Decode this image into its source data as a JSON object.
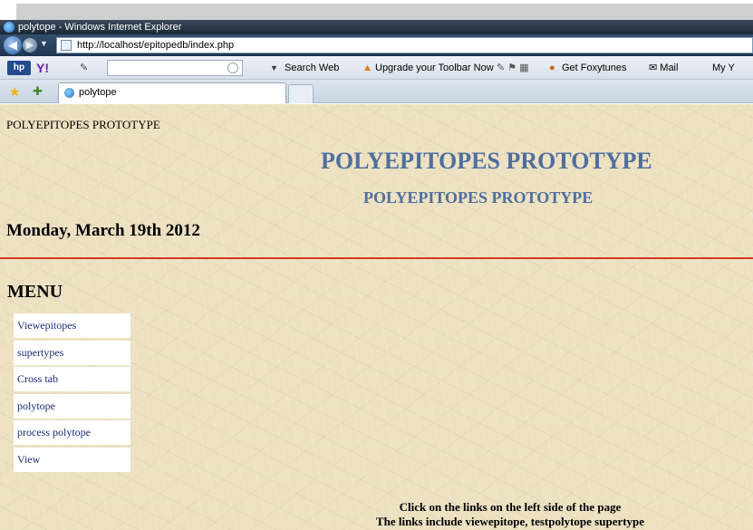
{
  "window": {
    "title": "polytope - Windows Internet Explorer",
    "url": "http://localhost/epitopedb/index.php"
  },
  "toolbar": {
    "y_label": "Y!",
    "search_web": "Search Web",
    "upgrade": "Upgrade your Toolbar Now",
    "get_foxytunes": "Get Foxytunes",
    "mail": "Mail",
    "my_y": "My Y"
  },
  "tab": {
    "label": "polytope"
  },
  "page": {
    "small_title": "POLYEPITOPES PROTOTYPE",
    "big_title": "POLYEPITOPES PROTOTYPE",
    "sub_title": "POLYEPITOPES PROTOTYPE",
    "date": "Monday, March 19th 2012",
    "menu_heading": "MENU",
    "menu_items": [
      {
        "label": "Viewepitopes"
      },
      {
        "label": "supertypes"
      },
      {
        "label": "Cross tab"
      },
      {
        "label": "polytope"
      },
      {
        "label": "process polytope"
      },
      {
        "label": "View"
      }
    ],
    "footer_line1": "Click on the links on the left side of the page",
    "footer_line2": "The links include viewepitope, testpolytope supertype"
  },
  "colors": {
    "heading_blue": "#4e6f9e",
    "rule_red": "#d23a22",
    "page_bg": "#ede1c2",
    "link_blue": "#1a2a78"
  },
  "icons": [
    "ie-icon",
    "back-arrow-icon",
    "forward-arrow-icon",
    "page-icon",
    "hp-logo-icon",
    "yahoo-icon",
    "pencil-icon",
    "search-icon",
    "warning-icon",
    "foxytunes-icon",
    "mail-icon",
    "favorites-star-icon",
    "add-favorites-icon",
    "tab-ie-icon"
  ]
}
